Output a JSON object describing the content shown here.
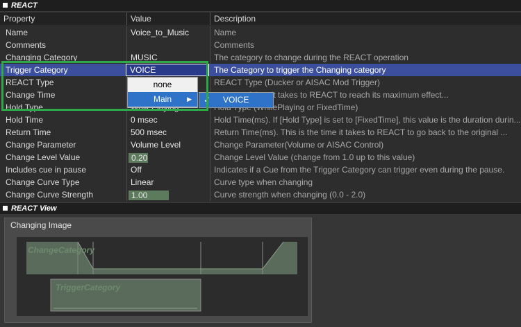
{
  "react_section": {
    "title": "REACT"
  },
  "columns": {
    "property": "Property",
    "value": "Value",
    "description": "Description"
  },
  "rows": [
    {
      "property": "Name",
      "value": "Voice_to_Music",
      "description": "Name"
    },
    {
      "property": "Comments",
      "value": "",
      "description": "Comments"
    },
    {
      "property": "Changing Category",
      "value": "MUSIC",
      "description": "The category to change during the REACT operation"
    },
    {
      "property": "Trigger Category",
      "value": "VOICE",
      "description": "The Category to trigger the Changing category"
    },
    {
      "property": "REACT Type",
      "value": "",
      "description": "REACT Type (Ducker or AISAC Mod Trigger)"
    },
    {
      "property": "Change Time",
      "value": "",
      "description": "amount of time it takes to REACT to reach its maximum effect..."
    },
    {
      "property": "Hold Type",
      "value": "WhilePlaying",
      "description": "Hold Type (WhilePlaying or FixedTime)"
    },
    {
      "property": "Hold Time",
      "value": "0 msec",
      "description": "Hold Time(ms). If [Hold Type] is set to [FixedTime], this value is the duration durin..."
    },
    {
      "property": "Return Time",
      "value": "500 msec",
      "description": "Return Time(ms). This is the time it takes to REACT to go back to the original ..."
    },
    {
      "property": "Change Parameter",
      "value": "Volume Level",
      "description": "Change Parameter(Volume or AISAC Control)"
    },
    {
      "property": "Change Level Value",
      "value": "0.20",
      "description": "Change Level Value (change from 1.0 up to this value)"
    },
    {
      "property": "Includes cue in pause",
      "value": "Off",
      "description": "Indicates if a Cue from the Trigger Category can trigger even during the pause."
    },
    {
      "property": "Change Curve Type",
      "value": "Linear",
      "description": "Curve type when changing"
    },
    {
      "property": "Change Curve Strength",
      "value": "1.00",
      "description": "Curve strength when changing (0.0 - 2.0)"
    }
  ],
  "menu": {
    "items": [
      "none",
      "Main"
    ]
  },
  "submenu": {
    "items": [
      "VOICE"
    ]
  },
  "view_section": {
    "title": "REACT View"
  },
  "view_panel": {
    "title": "Changing Image",
    "lane1": "ChangeCategory",
    "lane2": "TriggerCategory"
  },
  "colors": {
    "accent": "#2ea84a",
    "selection": "#3b4f9e",
    "menu_highlight": "#2f73c8"
  }
}
